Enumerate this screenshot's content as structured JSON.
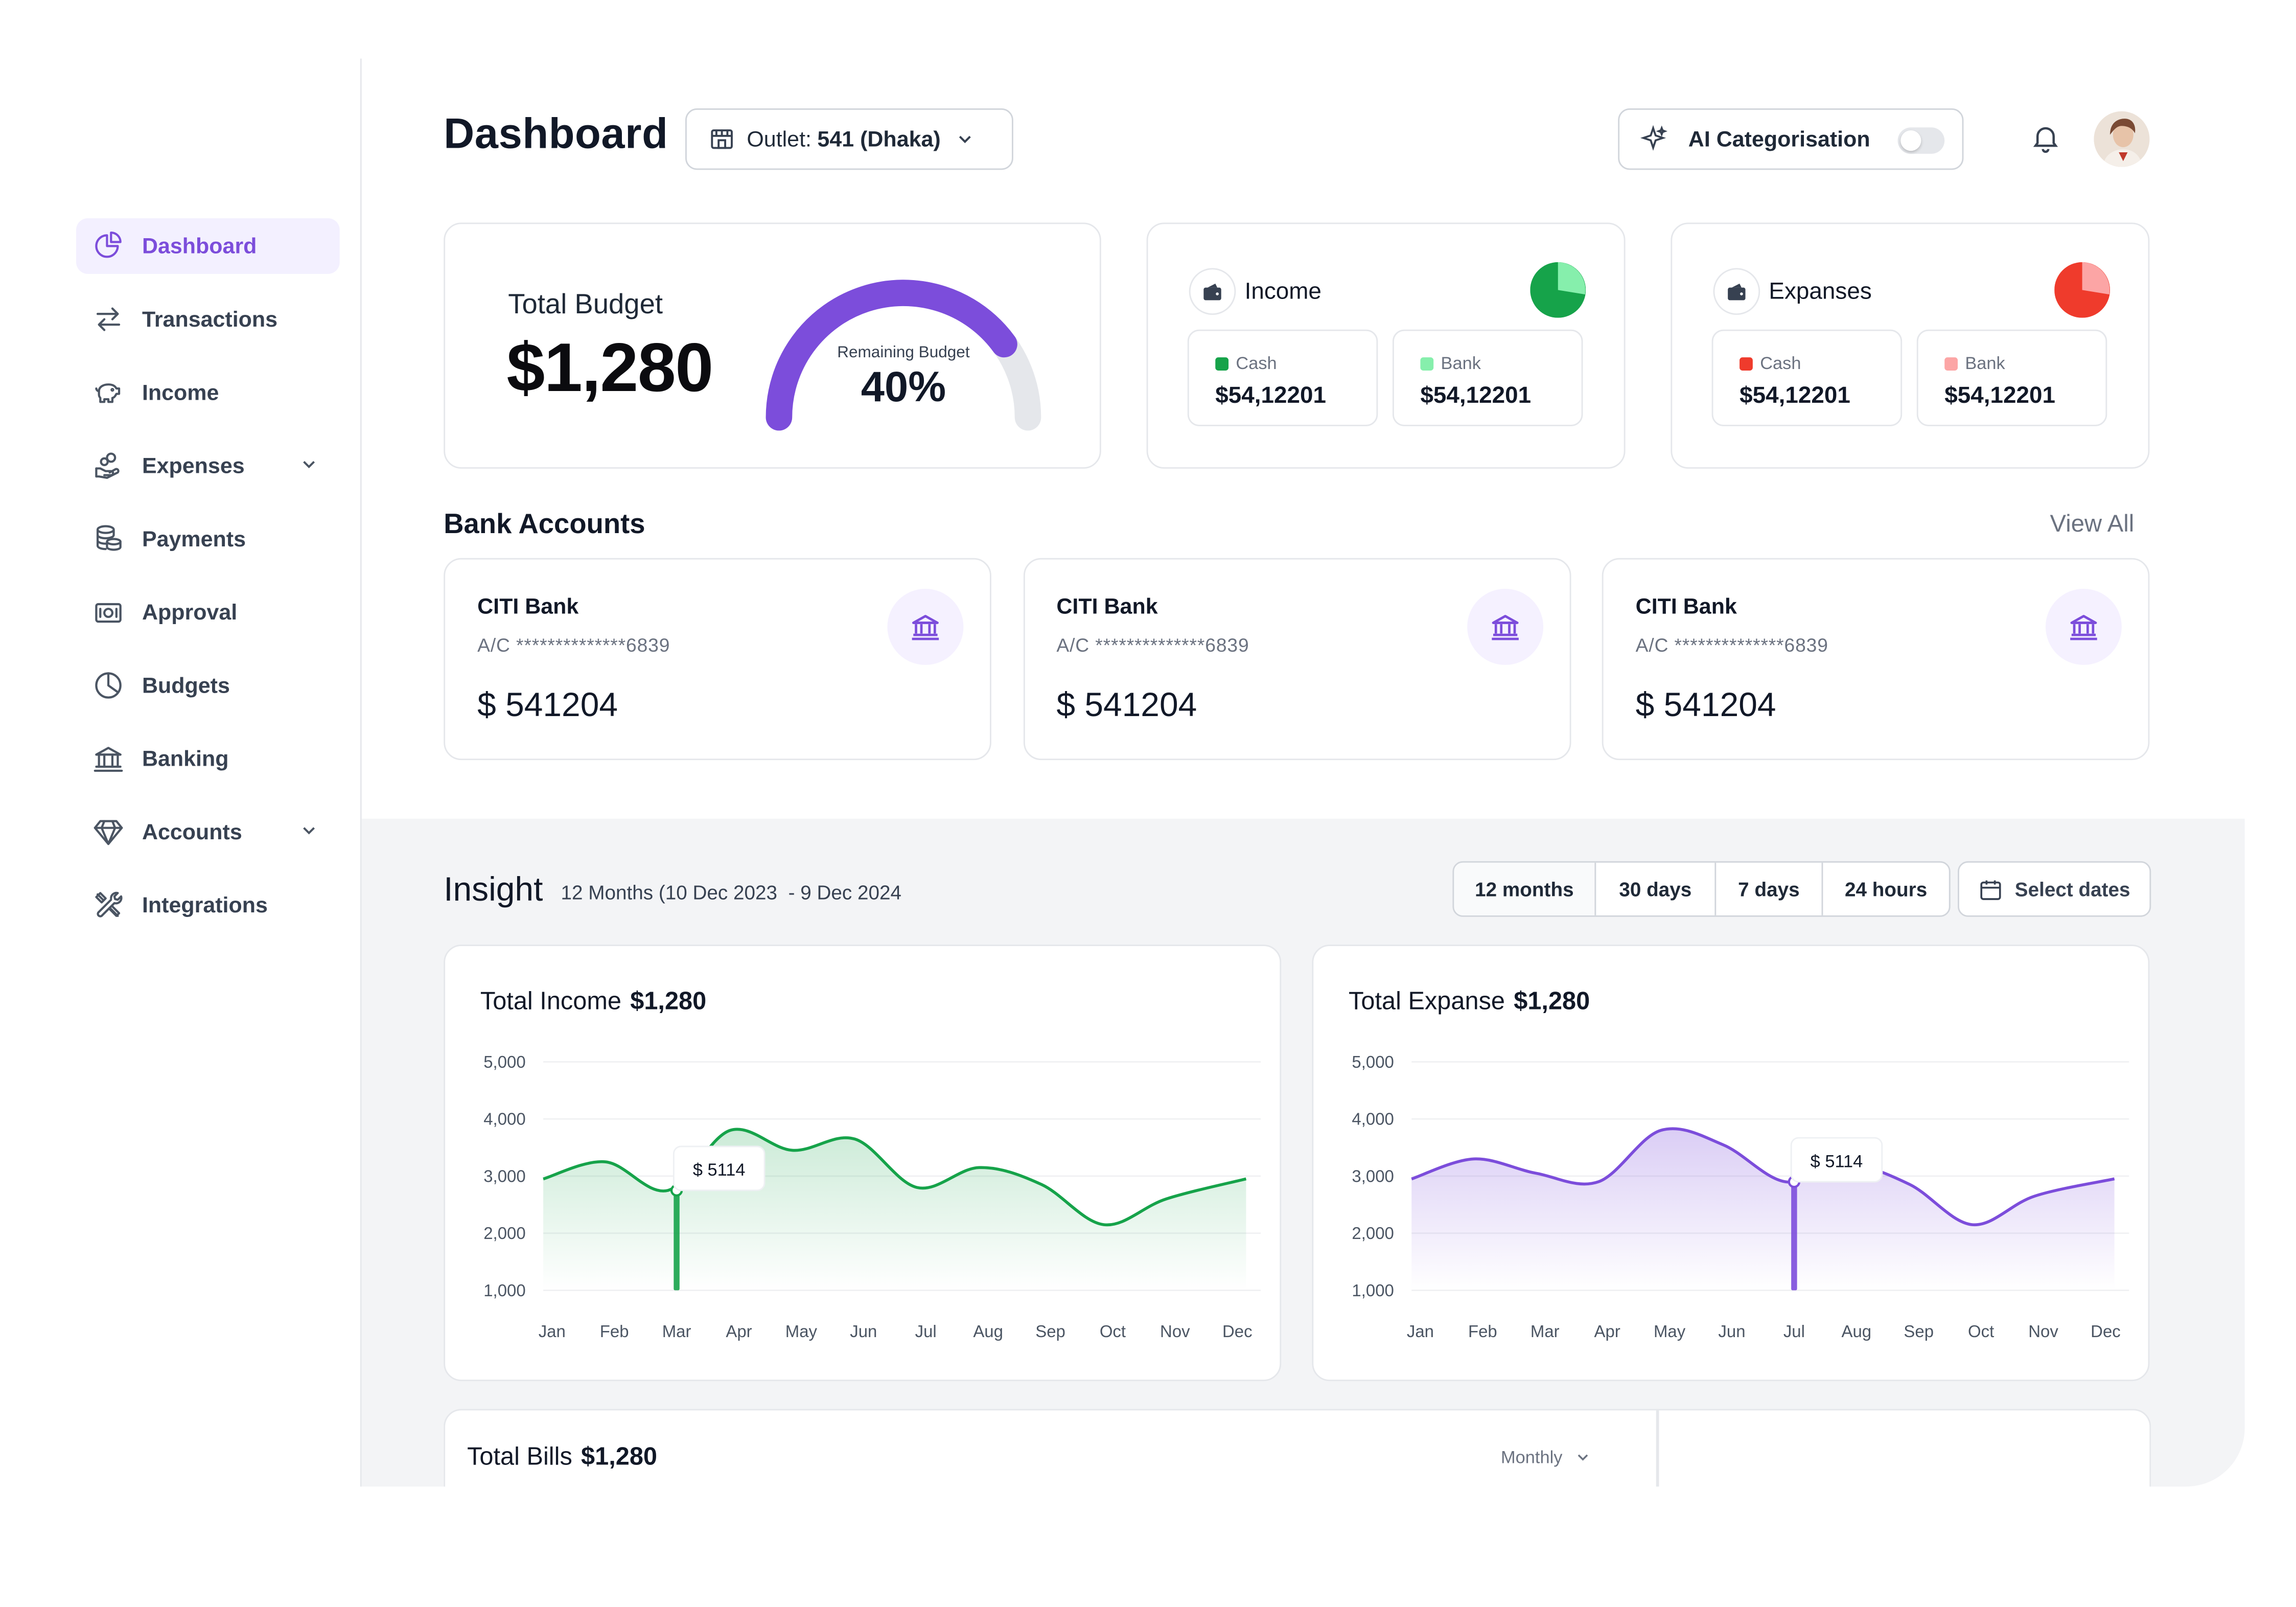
{
  "sidebar": {
    "items": [
      {
        "label": "Dashboard",
        "icon": "pie-chart-icon",
        "active": true
      },
      {
        "label": "Transactions",
        "icon": "arrows-swap-icon"
      },
      {
        "label": "Income",
        "icon": "piggy-bank-icon"
      },
      {
        "label": "Expenses",
        "icon": "hand-coins-icon",
        "expandable": true
      },
      {
        "label": "Payments",
        "icon": "coin-stack-icon"
      },
      {
        "label": "Approval",
        "icon": "banknote-icon"
      },
      {
        "label": "Budgets",
        "icon": "pie-slice-icon"
      },
      {
        "label": "Banking",
        "icon": "bank-building-icon"
      },
      {
        "label": "Accounts",
        "icon": "diamond-icon",
        "expandable": true
      },
      {
        "label": "Integrations",
        "icon": "tools-icon"
      }
    ]
  },
  "header": {
    "title": "Dashboard",
    "outlet_label": "Outlet:",
    "outlet_value": "541 (Dhaka)",
    "ai_label": "AI Categorisation",
    "ai_enabled": false
  },
  "budget": {
    "title": "Total Budget",
    "amount": "$1,280",
    "gauge_label": "Remaining Budget",
    "gauge_value": "40%",
    "gauge_fraction": 0.8,
    "accent": "#7c4ddb"
  },
  "income": {
    "title": "Income",
    "cash_label": "Cash",
    "cash_value": "$54,12201",
    "bank_label": "Bank",
    "bank_value": "$54,12201",
    "cash_color": "#16a34a",
    "bank_color": "#86efac"
  },
  "expenses": {
    "title": "Expanses",
    "cash_label": "Cash",
    "cash_value": "$54,12201",
    "bank_label": "Bank",
    "bank_value": "$54,12201",
    "cash_color": "#ef3b2c",
    "bank_color": "#fca5a5"
  },
  "bank_accounts": {
    "title": "Bank Accounts",
    "view_all": "View All",
    "accounts": [
      {
        "name": "CITI Bank",
        "account": "A/C **************6839",
        "balance": "$ 541204"
      },
      {
        "name": "CITI Bank",
        "account": "A/C **************6839",
        "balance": "$ 541204"
      },
      {
        "name": "CITI Bank",
        "account": "A/C **************6839",
        "balance": "$ 541204"
      }
    ]
  },
  "insight": {
    "title": "Insight",
    "range": "12 Months (10 Dec 2023  - 9 Dec 2024",
    "periods": [
      "12 months",
      "30 days",
      "7 days",
      "24 hours"
    ],
    "active_period": "12 months",
    "select_dates": "Select dates"
  },
  "chart_data": [
    {
      "type": "area",
      "title": "Total Income",
      "total": "$1,280",
      "x": [
        "Jan",
        "Feb",
        "Mar",
        "Apr",
        "May",
        "Jun",
        "Jul",
        "Aug",
        "Sep",
        "Oct",
        "Nov",
        "Dec"
      ],
      "y_ticks": [
        "5,000",
        "4,000",
        "3,000",
        "2,000",
        "1,000"
      ],
      "ylim": [
        1000,
        5000
      ],
      "series": [
        {
          "values": [
            2950,
            3250,
            2750,
            3800,
            3450,
            3650,
            2800,
            3150,
            2850,
            2150,
            2600,
            2950
          ]
        }
      ],
      "tooltip": {
        "month": "Mar",
        "label": "$ 5114"
      },
      "color": "#16a34a"
    },
    {
      "type": "area",
      "title": "Total Expanse",
      "total": "$1,280",
      "x": [
        "Jan",
        "Feb",
        "Mar",
        "Apr",
        "May",
        "Jun",
        "Jul",
        "Aug",
        "Sep",
        "Oct",
        "Nov",
        "Dec"
      ],
      "y_ticks": [
        "5,000",
        "4,000",
        "3,000",
        "2,000",
        "1,000"
      ],
      "ylim": [
        1000,
        5000
      ],
      "series": [
        {
          "values": [
            2950,
            3300,
            3050,
            2900,
            3800,
            3550,
            2900,
            3200,
            2850,
            2150,
            2650,
            2950
          ]
        }
      ],
      "tooltip": {
        "month": "Jul",
        "label": "$ 5114"
      },
      "color": "#7c4ddb"
    }
  ],
  "bills": {
    "title": "Total Bills",
    "amount": "$1,280",
    "period": "Monthly"
  }
}
